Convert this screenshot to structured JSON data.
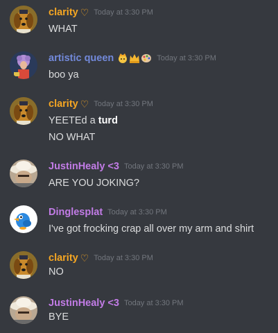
{
  "colors": {
    "background": "#36393f",
    "message_text": "#dcddde",
    "timestamp": "#72767d",
    "clarity": "#f5a623",
    "artistic_queen": "#7289da",
    "justin": "#c27ce6",
    "dinglesplat": "#c27ce6"
  },
  "messages": [
    {
      "username": "clarity",
      "heart": "♡",
      "timestamp": "Today at 3:30 PM",
      "avatar_icon": "dog-avatar-icon",
      "lines": [
        "WHAT"
      ]
    },
    {
      "username": "artistic queen",
      "badges": [
        "princess-emoji-icon",
        "crown-emoji-icon",
        "palette-emoji-icon"
      ],
      "timestamp": "Today at 3:30 PM",
      "avatar_icon": "artist-avatar-icon",
      "lines": [
        "boo ya"
      ]
    },
    {
      "username": "clarity",
      "heart": "♡",
      "timestamp": "Today at 3:30 PM",
      "avatar_icon": "dog-avatar-icon",
      "lines_rich": [
        {
          "plain": "YEETEd a ",
          "bold": "turd"
        }
      ],
      "lines": [
        "NO WHAT"
      ]
    },
    {
      "username": "JustinHealy <3",
      "timestamp": "Today at 3:30 PM",
      "avatar_icon": "hat-avatar-icon",
      "lines": [
        "ARE YOU JOKING?"
      ]
    },
    {
      "username": "Dinglesplat",
      "timestamp": "Today at 3:30 PM",
      "avatar_icon": "bird-avatar-icon",
      "lines": [
        "I've got frocking crap all over my arm and shirt"
      ]
    },
    {
      "username": "clarity",
      "heart": "♡",
      "timestamp": "Today at 3:30 PM",
      "avatar_icon": "dog-avatar-icon",
      "lines": [
        "NO"
      ]
    },
    {
      "username": "JustinHealy <3",
      "timestamp": "Today at 3:30 PM",
      "avatar_icon": "hat-avatar-icon",
      "lines": [
        "BYE"
      ]
    }
  ]
}
